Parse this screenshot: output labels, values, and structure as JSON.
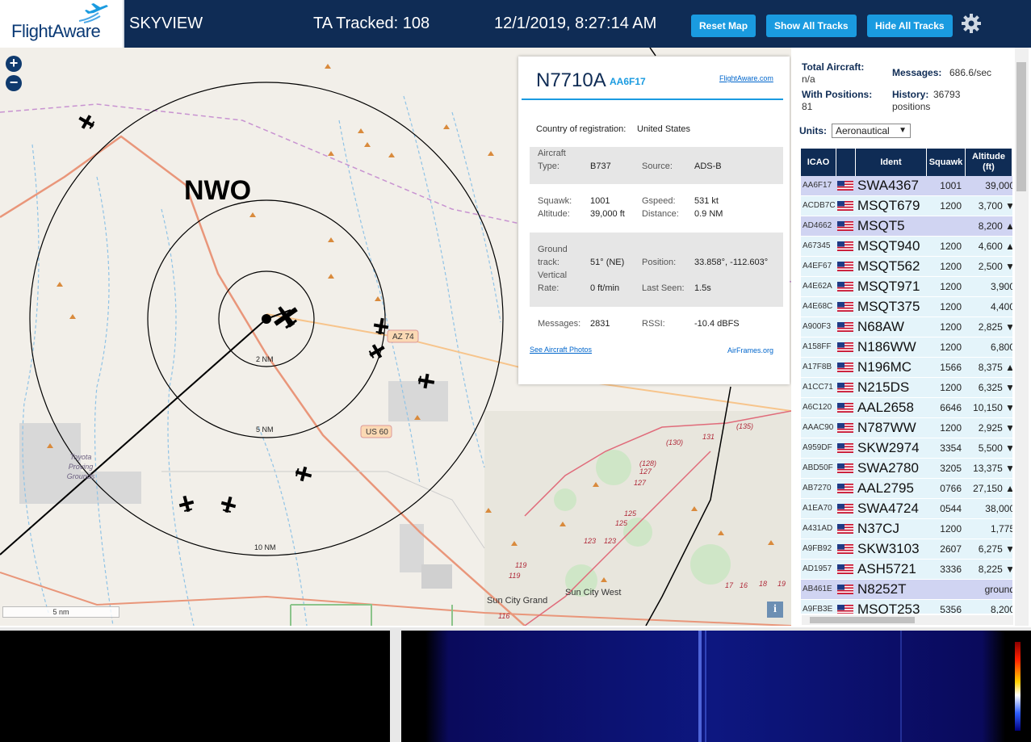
{
  "header": {
    "logo_text": "FlightAware",
    "app_name": "SKYVIEW",
    "tracked": "TA Tracked: 108",
    "datetime": "12/1/2019, 8:27:14 AM",
    "buttons": [
      "Reset Map",
      "Show All Tracks",
      "Hide All Tracks"
    ]
  },
  "map": {
    "area_label": "NWO",
    "ring_labels": [
      "2 NM",
      "5 NM",
      "10 NM"
    ],
    "road_labels": [
      "AZ 74",
      "US 60"
    ],
    "place_labels": [
      "Toyota",
      "Proving",
      "Grounds",
      "Sun City Grand",
      "Sun City West"
    ],
    "route_numbers": [
      "(130)",
      "131",
      "(135)",
      "(128)",
      "127",
      "127",
      "125",
      "125",
      "123",
      "123",
      "119",
      "119",
      "116",
      "17",
      "16",
      "18",
      "19"
    ],
    "scale": "5 nm",
    "info": "i"
  },
  "popup": {
    "registration": "N7710A",
    "hex": "AA6F17",
    "fa_link": "FlightAware.com",
    "country_label": "Country of registration:",
    "country": "United States",
    "aircraft_type_label_1": "Aircraft",
    "aircraft_type_label_2": "Type:",
    "aircraft_type": "B737",
    "source_label": "Source:",
    "source": "ADS-B",
    "squawk_label": "Squawk:",
    "squawk": "1001",
    "gspeed_label": "Gspeed:",
    "gspeed": "531 kt",
    "altitude_label": "Altitude:",
    "altitude": "39,000 ft",
    "distance_label": "Distance:",
    "distance": "0.9 NM",
    "track_label_1": "Ground",
    "track_label_2": "track:",
    "track": "51° (NE)",
    "position_label": "Position:",
    "position": "33.858°, -112.603°",
    "vrate_label_1": "Vertical",
    "vrate_label_2": "Rate:",
    "vrate": "0 ft/min",
    "lastseen_label": "Last Seen:",
    "lastseen": "1.5s",
    "messages_label": "Messages:",
    "messages": "2831",
    "rssi_label": "RSSI:",
    "rssi": "-10.4 dBFS",
    "photos_link": "See Aircraft Photos",
    "airframes_link": "AirFrames.org"
  },
  "stats": {
    "total_label": "Total Aircraft:",
    "total": "n/a",
    "messages_label": "Messages:",
    "messages": "686.6/sec",
    "positions_label": "With Positions:",
    "positions": "81",
    "history_label": "History:",
    "history": "36793",
    "history_unit": "positions",
    "units_label": "Units:",
    "units": "Aeronautical"
  },
  "table": {
    "headers": [
      "ICAO",
      "",
      "Ident",
      "Squawk",
      "Altitude\n(ft)"
    ],
    "rows": [
      {
        "icao": "AA6F17",
        "ident": "SWA4367",
        "squawk": "1001",
        "alt": "39,000",
        "sel": true
      },
      {
        "icao": "ACDB7C",
        "ident": "MSQT679",
        "squawk": "1200",
        "alt": "3,700 ▼"
      },
      {
        "icao": "AD4662",
        "ident": "MSQT5",
        "squawk": "",
        "alt": "8,200 ▲",
        "sel": true
      },
      {
        "icao": "A67345",
        "ident": "MSQT940",
        "squawk": "1200",
        "alt": "4,600 ▲"
      },
      {
        "icao": "A4EF67",
        "ident": "MSQT562",
        "squawk": "1200",
        "alt": "2,500 ▼"
      },
      {
        "icao": "A4E62A",
        "ident": "MSQT971",
        "squawk": "1200",
        "alt": "3,900"
      },
      {
        "icao": "A4E68C",
        "ident": "MSQT375",
        "squawk": "1200",
        "alt": "4,400"
      },
      {
        "icao": "A900F3",
        "ident": "N68AW",
        "squawk": "1200",
        "alt": "2,825 ▼"
      },
      {
        "icao": "A158FF",
        "ident": "N186WW",
        "squawk": "1200",
        "alt": "6,800"
      },
      {
        "icao": "A17F8B",
        "ident": "N196MC",
        "squawk": "1566",
        "alt": "8,375 ▲"
      },
      {
        "icao": "A1CC71",
        "ident": "N215DS",
        "squawk": "1200",
        "alt": "6,325 ▼"
      },
      {
        "icao": "A6C120",
        "ident": "AAL2658",
        "squawk": "6646",
        "alt": "10,150 ▼"
      },
      {
        "icao": "AAAC90",
        "ident": "N787WW",
        "squawk": "1200",
        "alt": "2,925 ▼"
      },
      {
        "icao": "A959DF",
        "ident": "SKW2974",
        "squawk": "3354",
        "alt": "5,500 ▼"
      },
      {
        "icao": "ABD50F",
        "ident": "SWA2780",
        "squawk": "3205",
        "alt": "13,375 ▼"
      },
      {
        "icao": "AB7270",
        "ident": "AAL2795",
        "squawk": "0766",
        "alt": "27,150 ▲"
      },
      {
        "icao": "A1EA70",
        "ident": "SWA4724",
        "squawk": "0544",
        "alt": "38,000"
      },
      {
        "icao": "A431AD",
        "ident": "N37CJ",
        "squawk": "1200",
        "alt": "1,775"
      },
      {
        "icao": "A9FB92",
        "ident": "SKW3103",
        "squawk": "2607",
        "alt": "6,275 ▼"
      },
      {
        "icao": "AD1957",
        "ident": "ASH5721",
        "squawk": "3336",
        "alt": "8,225 ▼"
      },
      {
        "icao": "AB461E",
        "ident": "N8252T",
        "squawk": "",
        "alt": "ground",
        "sel": true
      },
      {
        "icao": "A9FB3E",
        "ident": "MSQT253",
        "squawk": "5356",
        "alt": "8,200"
      }
    ]
  },
  "colors": {
    "header_bg": "#0f2c55",
    "button_bg": "#1a9be0",
    "row_bg": "#e4f4fa",
    "row_selected": "#d0d4f2"
  }
}
